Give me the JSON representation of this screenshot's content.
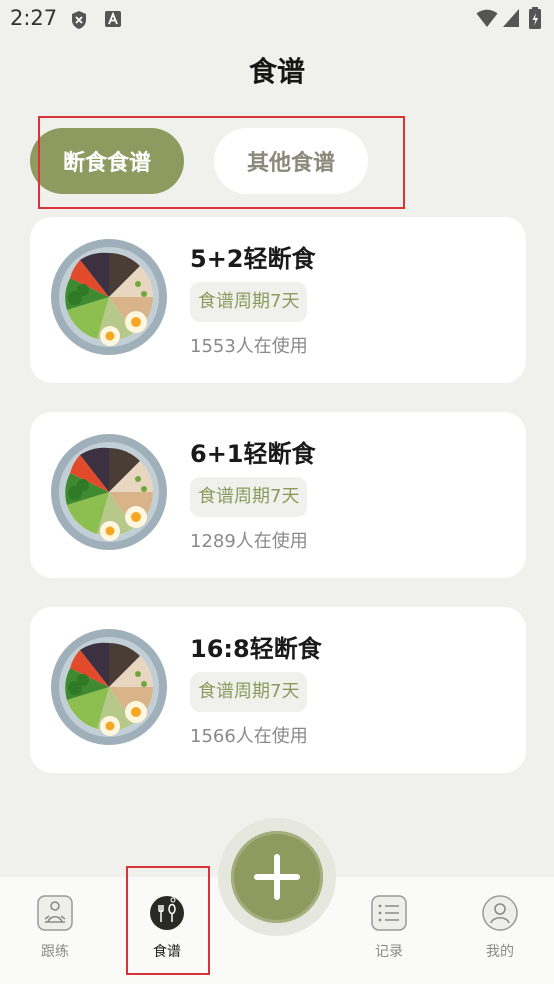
{
  "status_bar": {
    "time": "2:27"
  },
  "header": {
    "title": "食谱"
  },
  "tabs": [
    {
      "label": "断食食谱",
      "active": true
    },
    {
      "label": "其他食谱",
      "active": false
    }
  ],
  "recipes": [
    {
      "title": "5+2轻断食",
      "badge": "食谱周期7天",
      "users": "1553人在使用"
    },
    {
      "title": "6+1轻断食",
      "badge": "食谱周期7天",
      "users": "1289人在使用"
    },
    {
      "title": "16:8轻断食",
      "badge": "食谱周期7天",
      "users": "1566人在使用"
    }
  ],
  "bottom_nav": {
    "items": [
      {
        "label": "跟练",
        "icon": "meditation-icon"
      },
      {
        "label": "食谱",
        "icon": "fork-spoon-icon",
        "active": true
      },
      {
        "label": "记录",
        "icon": "list-icon"
      },
      {
        "label": "我的",
        "icon": "user-icon"
      }
    ],
    "fab_icon": "plus-icon"
  },
  "colors": {
    "accent": "#8e9a5f",
    "background": "#f0f1ec",
    "highlight": "#d9333a"
  }
}
